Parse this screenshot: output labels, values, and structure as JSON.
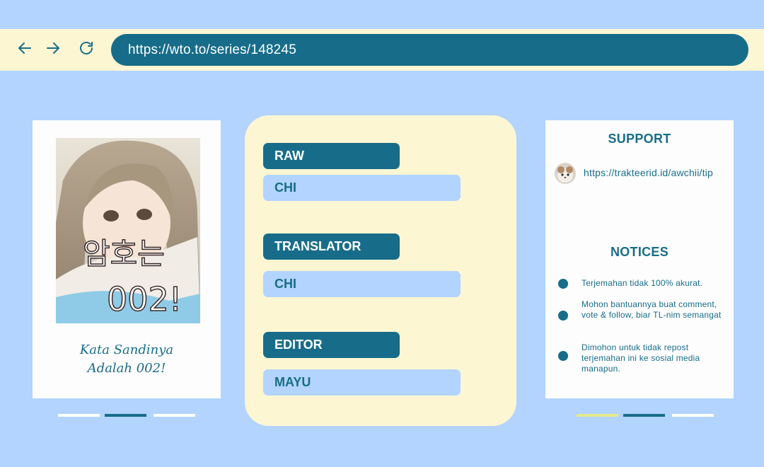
{
  "browser": {
    "url": "https://wto.to/series/148245",
    "back_icon": "arrow-left-icon",
    "forward_icon": "arrow-right-icon",
    "reload_icon": "reload-icon"
  },
  "cover": {
    "title_line1": "Kata Sandinya",
    "title_line2": "Adalah 002!",
    "korean_title_line1": "암호는",
    "korean_title_line2": "002!"
  },
  "credits": [
    {
      "role": "RAW",
      "name": "CHI"
    },
    {
      "role": "TRANSLATOR",
      "name": "CHI"
    },
    {
      "role": "EDITOR",
      "name": "MAYU"
    }
  ],
  "support": {
    "title": "SUPPORT",
    "link": "https://trakteerid.id/awchii/tip"
  },
  "notices": {
    "title": "NOTICES",
    "items": [
      "Terjemahan tidak 100% akurat.",
      "Mohon bantuannya buat comment, vote & follow, biar TL-nim semangat",
      "Dimohon untuk tidak repost terjemahan ini ke sosial media manapun."
    ]
  },
  "colors": {
    "background": "#b2d4fe",
    "bar": "#fdf6d3",
    "accent": "#176d89",
    "indicator_active_yellow": "#e6e98a"
  }
}
